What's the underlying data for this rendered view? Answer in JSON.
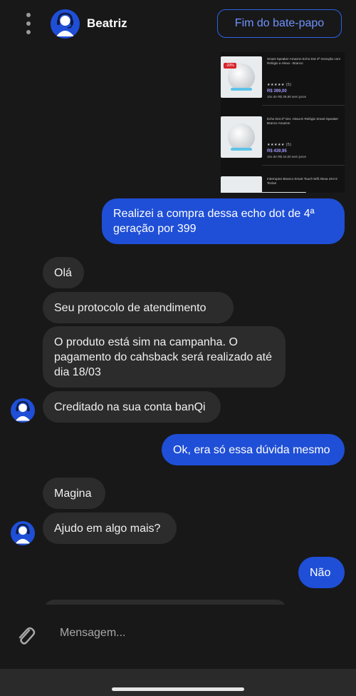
{
  "header": {
    "agent_name": "Beatriz",
    "end_chat_label": "Fim do bate-papo"
  },
  "product_screenshot": {
    "items": [
      {
        "title": "Smart Speaker Amazon Echo Dot 4ª Geração com Relógio e Alexa - Branco",
        "discount": "-20%",
        "stars": "★★★★★ (5)",
        "price": "R$ 399,00",
        "installment": "10x de R$ 39,90 sem juros"
      },
      {
        "title": "Echo Dot 4ª Ger. Alexa E Relógio Smart Speaker Branco Amazon",
        "stars": "★★★★★ (5)",
        "price": "R$ 439,95",
        "installment": "10x de R$ 44,00 sem juros"
      },
      {
        "title": "Interruptor Branco Smart Touch Wifi Alexa 4X4 6 Teclas"
      }
    ]
  },
  "messages": [
    {
      "text": "Realizei a compra dessa echo dot de 4ª geração por 399",
      "direction": "out"
    },
    {
      "text": "Olá",
      "direction": "in"
    },
    {
      "text": "Seu protocolo de atendimento",
      "direction": "in"
    },
    {
      "text": "O produto está sim na campanha. O pagamento do cahsback será realizado até dia 18/03",
      "direction": "in"
    },
    {
      "text": "Creditado na sua conta banQi",
      "direction": "in"
    },
    {
      "text": "Ok, era só essa dúvida mesmo",
      "direction": "out"
    },
    {
      "text": "Magina",
      "direction": "in"
    },
    {
      "text": "Ajudo em algo mais?",
      "direction": "in"
    },
    {
      "text": "Não",
      "direction": "out"
    }
  ],
  "composer": {
    "placeholder": "Mensagem..."
  },
  "colors": {
    "background": "#181818",
    "outgoing_bubble": "#1f4fd6",
    "incoming_bubble": "#2c2c2c",
    "accent": "#2b62e8"
  },
  "icons": [
    "menu-dots-icon",
    "agent-headset-avatar-icon",
    "paperclip-icon"
  ]
}
